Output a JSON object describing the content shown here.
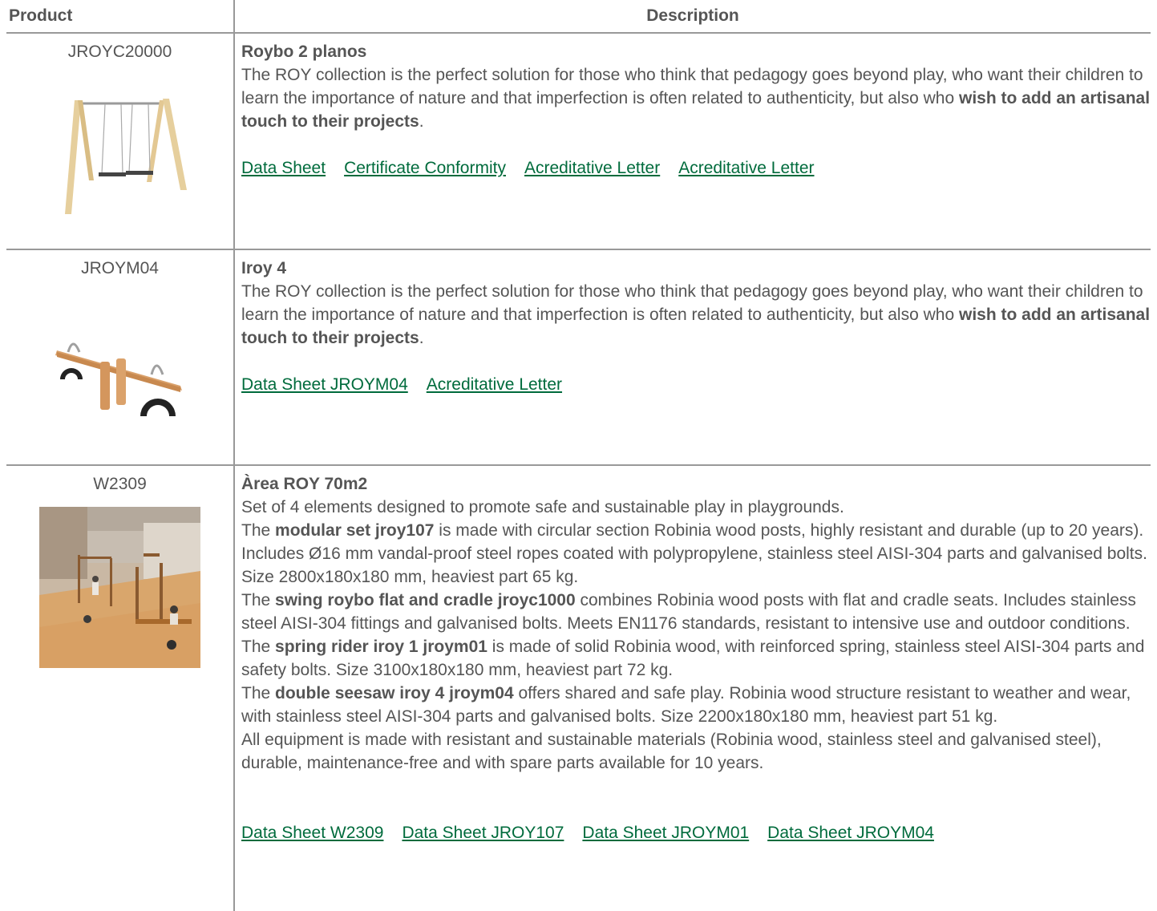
{
  "header": {
    "product": "Product",
    "description": "Description"
  },
  "rows": [
    {
      "code": "JROYC20000",
      "title": "Roybo 2 planos",
      "intro": "The ROY collection is the perfect solution for those who think that pedagogy goes beyond play, who want their children to learn the importance of nature and that imperfection is often related to authenticity, but also who ",
      "intro_bold": "wish to add an artisanal touch to their projects",
      "intro_end": ".",
      "links": [
        "Data Sheet",
        "Certificate Conformity",
        "Acreditative Letter",
        "Acreditative Letter"
      ]
    },
    {
      "code": "JROYM04",
      "title": "Iroy 4",
      "intro": "The ROY collection is the perfect solution for those who think that pedagogy goes beyond play, who want their children to learn the importance of nature and that imperfection is often related to authenticity, but also who ",
      "intro_bold": "wish to add an artisanal touch to their projects",
      "intro_end": ".",
      "links": [
        "Data Sheet JROYM04",
        "Acreditative Letter"
      ]
    },
    {
      "code": "W2309",
      "title": "Àrea ROY 70m2",
      "p1": "Set of 4 elements designed to promote safe and sustainable play in playgrounds.",
      "p2_pre": "The ",
      "p2_bold": "modular set jroy107",
      "p2_post": " is made with circular section Robinia wood posts, highly resistant and durable (up to 20 years). Includes Ø16 mm vandal-proof steel ropes coated with polypropylene, stainless steel AISI-304 parts and galvanised bolts. Size 2800x180x180 mm, heaviest part 65 kg.",
      "p3_pre": "The ",
      "p3_bold": "swing roybo flat and cradle jroyc1000",
      "p3_post": " combines Robinia wood posts with flat and cradle seats. Includes stainless steel AISI-304 fittings and galvanised bolts. Meets EN1176 standards, resistant to intensive use and outdoor conditions.",
      "p4_pre": "The ",
      "p4_bold": "spring rider iroy 1 jroym01",
      "p4_post": " is made of solid Robinia wood, with reinforced spring, stainless steel AISI-304 parts and safety bolts. Size 3100x180x180 mm, heaviest part 72 kg.",
      "p5_pre": "The ",
      "p5_bold": "double seesaw iroy 4 jroym04",
      "p5_post": " offers shared and safe play. Robinia wood structure resistant to weather and wear, with stainless steel AISI-304 parts and galvanised bolts. Size 2200x180x180 mm, heaviest part 51 kg.",
      "p6": "All equipment is made with resistant and sustainable materials (Robinia wood, stainless steel and galvanised steel), durable, maintenance-free and with spare parts available for 10 years.",
      "links": [
        "Data Sheet W2309",
        "Data Sheet JROY107",
        "Data Sheet JROYM01",
        "Data Sheet JROYM04"
      ]
    }
  ],
  "colors": {
    "text": "#555555",
    "link": "#006b3c",
    "rule": "#999999"
  }
}
